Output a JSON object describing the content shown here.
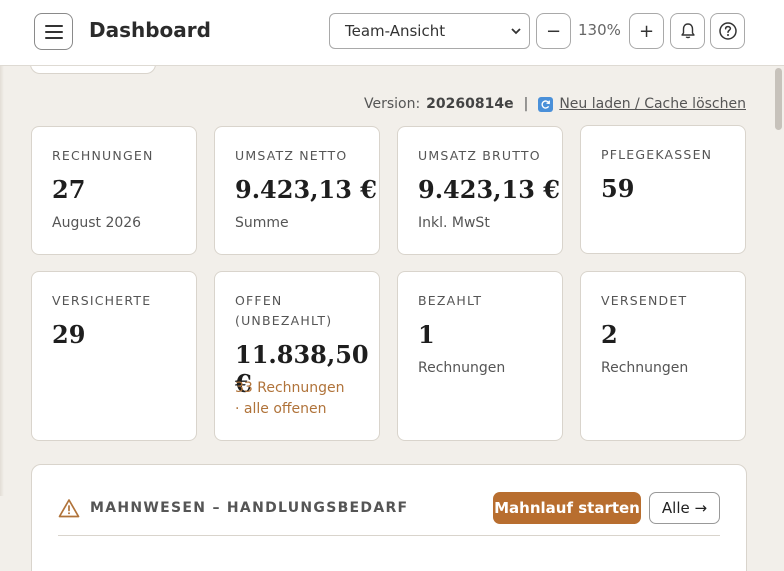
{
  "header": {
    "title": "Dashboard",
    "view_select": "Team-Ansicht",
    "zoom_minus": "−",
    "zoom_value": "130%",
    "zoom_plus": "+"
  },
  "version": {
    "label": "Version:",
    "number": "20260814e",
    "separator": "|",
    "reload_link": "Neu laden / Cache löschen"
  },
  "cards": [
    {
      "label": "RECHNUNGEN",
      "value": "27",
      "sub": "August 2026"
    },
    {
      "label": "UMSATZ NETTO",
      "value": "9.423,13 €",
      "sub": "Summe"
    },
    {
      "label": "UMSATZ BRUTTO",
      "value": "9.423,13 €",
      "sub": "Inkl. MwSt"
    },
    {
      "label": "PFLEGEKASSEN",
      "value": "59",
      "sub": ""
    },
    {
      "label": "VERSICHERTE",
      "value": "29",
      "sub": ""
    },
    {
      "label": "OFFEN (UNBEZAHLT)",
      "value": "11.838,50 €",
      "sub": "33 Rechnungen · alle offenen"
    },
    {
      "label": "BEZAHLT",
      "value": "1",
      "sub": "Rechnungen"
    },
    {
      "label": "VERSENDET",
      "value": "2",
      "sub": "Rechnungen"
    }
  ],
  "dunning": {
    "title": "MAHNWESEN – HANDLUNGSBEDARF",
    "run_button": "Mahnlauf starten",
    "all_button": "Alle →"
  },
  "colors": {
    "background": "#f2efea",
    "accent": "#b86e2f",
    "warning_text": "#b0733a",
    "reload_icon": "#4a90d9"
  },
  "icons": [
    "menu-icon",
    "chevron-down-icon",
    "bell-icon",
    "help-icon",
    "reload-icon",
    "warning-icon"
  ]
}
